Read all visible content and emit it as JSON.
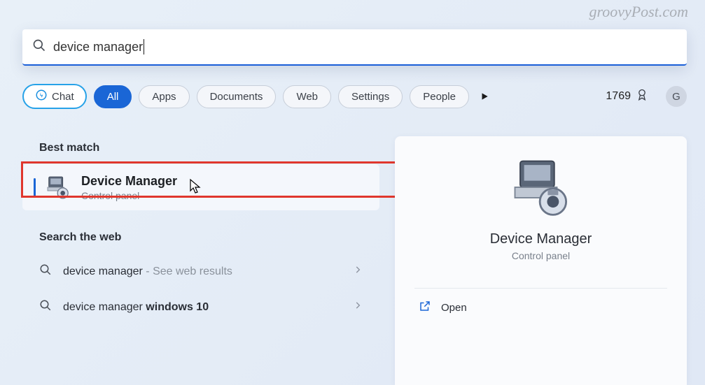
{
  "watermark": "groovyPost.com",
  "search": {
    "query": "device manager"
  },
  "filters": {
    "chat": "Chat",
    "all": "All",
    "apps": "Apps",
    "documents": "Documents",
    "web": "Web",
    "settings": "Settings",
    "people": "People"
  },
  "rewards": {
    "points": "1769"
  },
  "avatar": {
    "initial": "G"
  },
  "results": {
    "best_match_heading": "Best match",
    "item": {
      "title": "Device Manager",
      "subtitle": "Control panel"
    },
    "search_web_heading": "Search the web",
    "web": [
      {
        "text": "device manager",
        "suffix": " - See web results"
      },
      {
        "text_prefix": "device manager ",
        "text_bold": "windows 10"
      }
    ]
  },
  "details": {
    "title": "Device Manager",
    "subtitle": "Control panel",
    "actions": {
      "open": "Open"
    }
  }
}
